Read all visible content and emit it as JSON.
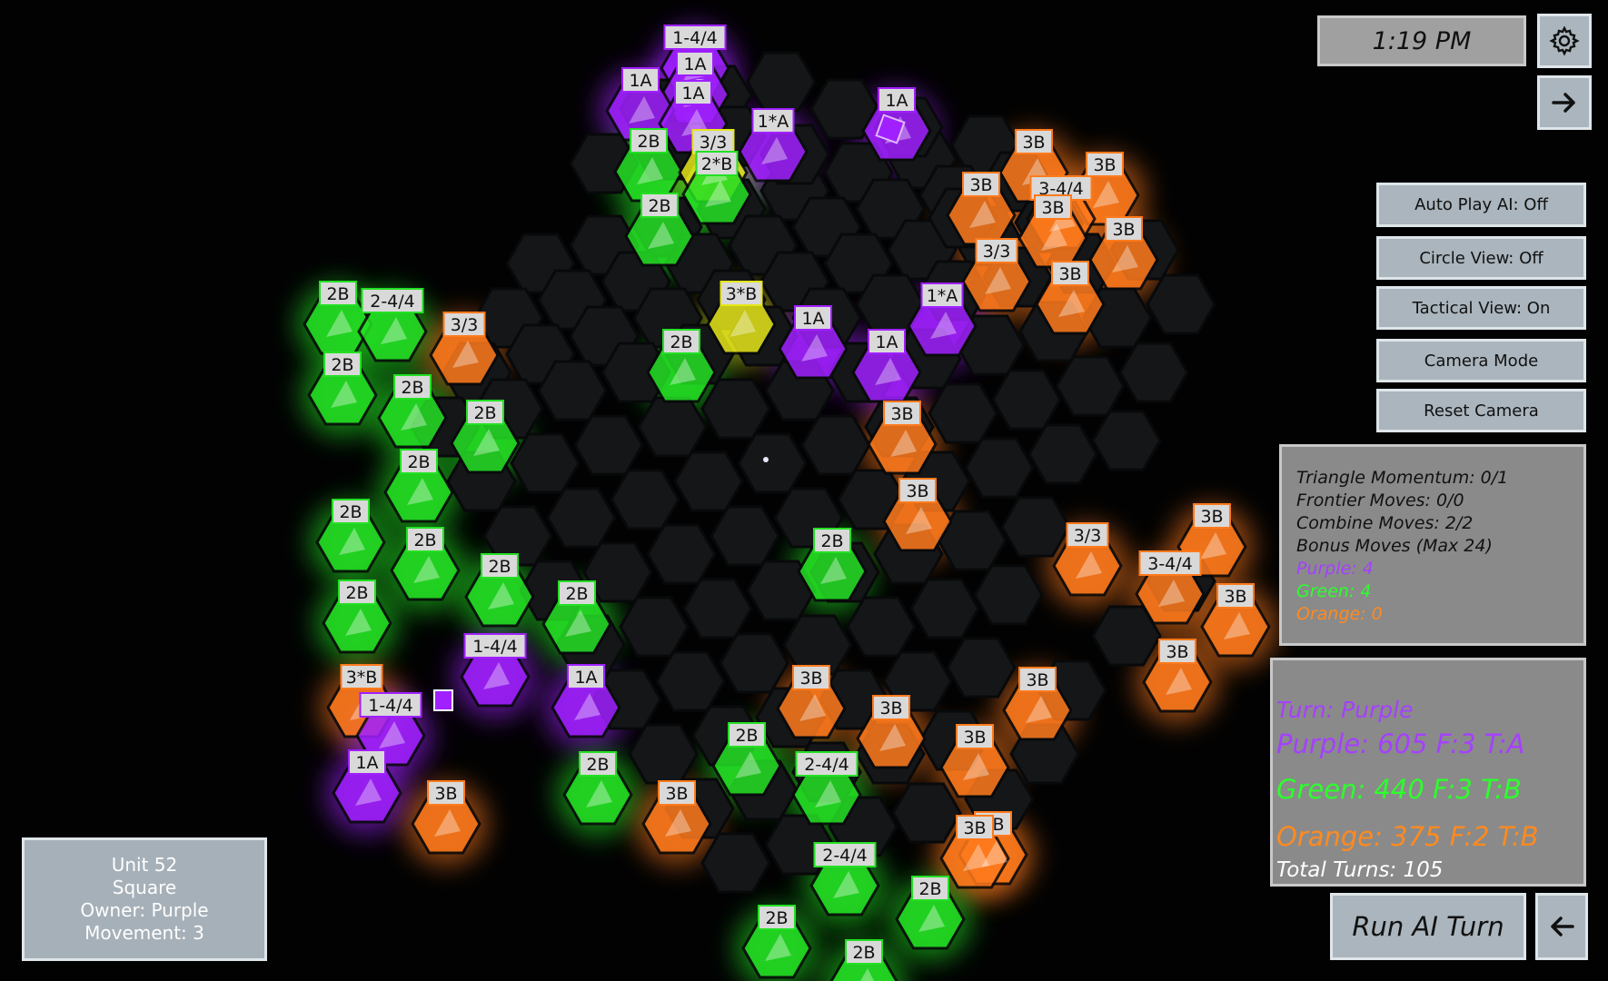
{
  "clock": {
    "time": "1:19 PM"
  },
  "icons": {
    "settings": "gear-icon",
    "forward": "arrow-right-icon",
    "back": "arrow-left-icon"
  },
  "buttons": {
    "auto_play": "Auto Play AI: Off",
    "circle_view": "Circle View: Off",
    "tactical_view": "Tactical View: On",
    "camera_mode": "Camera Mode",
    "reset_camera": "Reset Camera",
    "run_ai": "Run AI Turn"
  },
  "stats": {
    "triangle_momentum": "Triangle Momentum: 0/1",
    "frontier_moves": "Frontier Moves: 0/0",
    "combine_moves": "Combine Moves: 2/2",
    "bonus_moves": "Bonus Moves (Max 24)",
    "purple": "Purple: 4",
    "green": "Green: 4",
    "orange": "Orange: 0"
  },
  "score": {
    "turn": "Turn: Purple",
    "purple": "Purple: 605 F:3 T:A",
    "green": "Green: 440 F:3 T:B",
    "orange": "Orange: 375 F:2 T:B",
    "total_turns": "Total Turns: 105"
  },
  "unit": {
    "id": "Unit 52",
    "shape": "Square",
    "owner": "Owner: Purple",
    "movement": "Movement: 3"
  },
  "colors": {
    "purple": "#a020ff",
    "green": "#24e024",
    "orange": "#ff7a1c",
    "yellow": "#e6e61a",
    "empty_tile": "#141618",
    "purple_text": "#a540ff",
    "green_text": "#2dff2d",
    "orange_text": "#ff8a20"
  },
  "board": {
    "tile_labels": [
      {
        "text": "1-4/4",
        "owner": "purple"
      },
      {
        "text": "1A",
        "owner": "purple"
      },
      {
        "text": "1A",
        "owner": "purple"
      },
      {
        "text": "1A",
        "owner": "purple"
      },
      {
        "text": "2B",
        "owner": "green"
      },
      {
        "text": "3/3",
        "owner": "yellow"
      },
      {
        "text": "2*B",
        "owner": "green"
      },
      {
        "text": "1*A",
        "owner": "purple"
      },
      {
        "text": "1A",
        "owner": "purple"
      },
      {
        "text": "2B",
        "owner": "green"
      },
      {
        "text": "3B",
        "owner": "orange"
      },
      {
        "text": "3B",
        "owner": "orange"
      },
      {
        "text": "3B",
        "owner": "orange"
      },
      {
        "text": "3-4/4",
        "owner": "orange"
      },
      {
        "text": "3B",
        "owner": "orange"
      },
      {
        "text": "3B",
        "owner": "orange"
      },
      {
        "text": "3/3",
        "owner": "orange"
      },
      {
        "text": "3B",
        "owner": "orange"
      },
      {
        "text": "2B",
        "owner": "green"
      },
      {
        "text": "2-4/4",
        "owner": "green"
      },
      {
        "text": "3/3",
        "owner": "orange"
      },
      {
        "text": "3*B",
        "owner": "yellow"
      },
      {
        "text": "1*A",
        "owner": "purple"
      },
      {
        "text": "2B",
        "owner": "green"
      },
      {
        "text": "1A",
        "owner": "purple"
      },
      {
        "text": "1A",
        "owner": "purple"
      },
      {
        "text": "2B",
        "owner": "green"
      },
      {
        "text": "2B",
        "owner": "green"
      },
      {
        "text": "2B",
        "owner": "green"
      },
      {
        "text": "3B",
        "owner": "orange"
      },
      {
        "text": "2B",
        "owner": "green"
      },
      {
        "text": "3B",
        "owner": "orange"
      },
      {
        "text": "2B",
        "owner": "green"
      },
      {
        "text": "2B",
        "owner": "green"
      },
      {
        "text": "2B",
        "owner": "green"
      },
      {
        "text": "3/3",
        "owner": "orange"
      },
      {
        "text": "3B",
        "owner": "orange"
      },
      {
        "text": "2B",
        "owner": "green"
      },
      {
        "text": "3-4/4",
        "owner": "orange"
      },
      {
        "text": "2B",
        "owner": "green"
      },
      {
        "text": "2B",
        "owner": "green"
      },
      {
        "text": "3B",
        "owner": "orange"
      },
      {
        "text": "1-4/4",
        "owner": "purple"
      },
      {
        "text": "3B",
        "owner": "orange"
      },
      {
        "text": "1A",
        "owner": "purple"
      },
      {
        "text": "3*B",
        "owner": "orange"
      },
      {
        "text": "3B",
        "owner": "orange"
      },
      {
        "text": "3B",
        "owner": "orange"
      },
      {
        "text": "1-4/4",
        "owner": "purple"
      },
      {
        "text": "3B",
        "owner": "orange"
      },
      {
        "text": "2B",
        "owner": "green"
      },
      {
        "text": "3B",
        "owner": "orange"
      },
      {
        "text": "1A",
        "owner": "purple"
      },
      {
        "text": "2B",
        "owner": "green"
      },
      {
        "text": "2-4/4",
        "owner": "green"
      },
      {
        "text": "3B",
        "owner": "orange"
      },
      {
        "text": "3B",
        "owner": "orange"
      },
      {
        "text": "3B",
        "owner": "orange"
      },
      {
        "text": "3B",
        "owner": "orange"
      },
      {
        "text": "2-4/4",
        "owner": "green"
      },
      {
        "text": "2B",
        "owner": "green"
      },
      {
        "text": "2B",
        "owner": "green"
      },
      {
        "text": "2B",
        "owner": "green"
      }
    ]
  }
}
